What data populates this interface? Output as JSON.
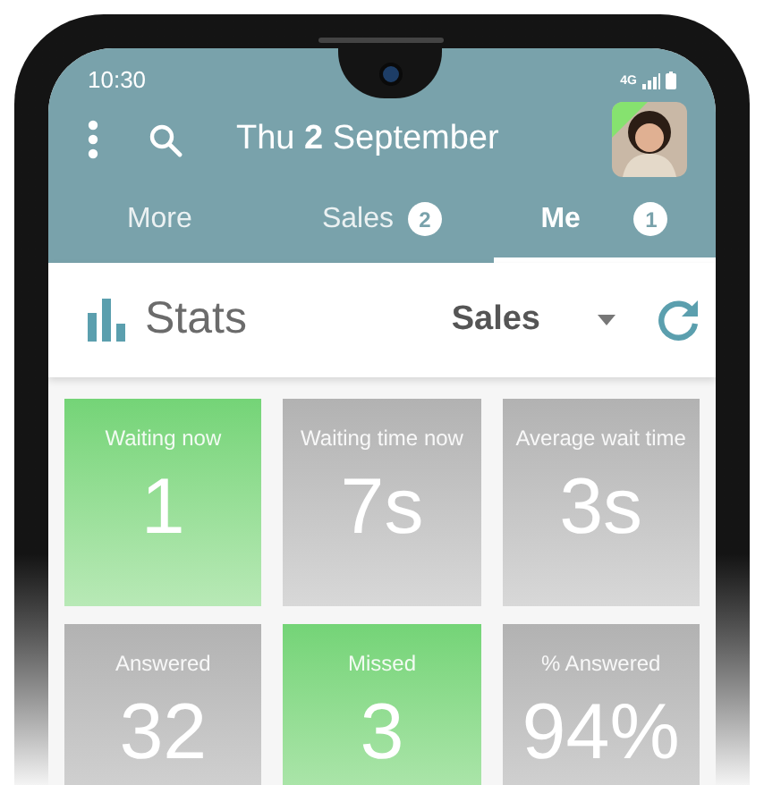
{
  "status_bar": {
    "time": "10:30",
    "network": "4G"
  },
  "toolbar": {
    "date": "Thu **2** September"
  },
  "tabs": [
    {
      "label": "More",
      "selected": false
    },
    {
      "label": "Sales",
      "badge": "2",
      "selected": false
    },
    {
      "label": "Me",
      "badge": "1",
      "selected": true
    }
  ],
  "stats_bar": {
    "title": "Stats",
    "dropdown": {
      "value": "Sales"
    }
  },
  "tiles": [
    {
      "label": "Waiting now",
      "value": "1",
      "highlighted": true
    },
    {
      "label": "Waiting time now",
      "value": "7s",
      "highlighted": false
    },
    {
      "label": "Average wait time",
      "value": "3s",
      "highlighted": false
    },
    {
      "label": "Answered",
      "value": "32",
      "highlighted": false
    },
    {
      "label": "Missed",
      "value": "3",
      "highlighted": true
    },
    {
      "label": "% Answered",
      "value": "94%",
      "highlighted": false
    }
  ]
}
